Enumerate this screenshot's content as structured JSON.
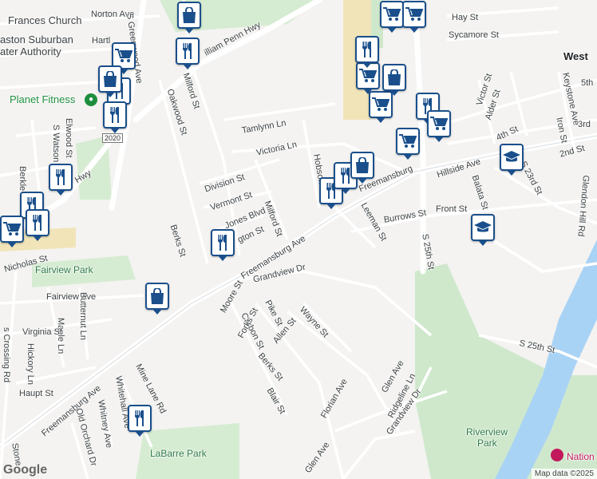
{
  "map": {
    "attribution": "Map data ©2025",
    "logo": "Google",
    "route_badge": "2020",
    "colors": {
      "background": "#f4f3f1",
      "park": "#c8e6c9",
      "water": "#a9d3f5",
      "road": "#ffffff",
      "highlight": "#f1e4b8",
      "marker_border": "#1a4f8b"
    }
  },
  "places": {
    "church": "Frances Church",
    "authority_1": "aston Suburban",
    "authority_2": "ater Authority",
    "gym": "Planet Fitness",
    "fairview_park": "Fairview Park",
    "labarre_park": "LaBarre Park",
    "riverview_1": "Riverview",
    "riverview_2": "Park",
    "west": "West",
    "national": "Nation"
  },
  "streets": {
    "norton": "Norton Ave",
    "hartl": "Hartl",
    "greenwood": "S Greenwood Ave",
    "penn_hwy": "illiam Penn Hwy",
    "milford_top": "Milford St",
    "oakwood": "Oakwood St",
    "tamlynn": "Tamlynn Ln",
    "victoria": "Victoria Ln",
    "division": "Division St",
    "vermont": "Vermont St",
    "jones": "Jones Blvd",
    "milford_mid": "Milford St",
    "hobson": "Hobson",
    "freemansburg_top": "Freemansburg",
    "leeman": "Leeman St",
    "burrows": "Burrows St",
    "front": "Front St",
    "s25": "S 25th St",
    "berks": "Berks St",
    "lexington": "gton St",
    "freemansburg_mid": "Freemansburg Ave",
    "grandview": "Grandview Dr",
    "moore": "Moore St",
    "carbon": "Carbon St",
    "pike": "Pike St",
    "wayne": "Wayne St",
    "forks": "Forks St",
    "allen": "Allen St",
    "berks2": "Berks St",
    "blair": "Blair St",
    "florian": "Florian Ave",
    "glen_ave_top": "Glen Ave",
    "ridgeline": "Ridgeline Ln",
    "grandview2": "Grandview Dr",
    "glen_ave_bot": "Glen Ave",
    "s25th_st": "S 25th St",
    "hay": "Hay St",
    "sycamore": "Sycamore St",
    "victor": "Victor St",
    "alder": "Alder St",
    "4th": "4th St",
    "3rd": "3rd",
    "2nd": "2nd St",
    "5th": "5th",
    "keystone": "Keystone Ave",
    "iron": "Iron St",
    "s23": "S 23rd St",
    "balata": "Balata St",
    "hillside": "Hillside Ave",
    "glendon": "Glendon Hill Rd",
    "elwood": "Elwood St",
    "watson": "S Watson St",
    "berkley": "Berkle",
    "nicholas": "Nicholas St",
    "fairview_ave": "Fairview Ave",
    "butternut": "Butternut Ln",
    "maple": "Maple Ln",
    "virginia": "Virginia St",
    "hickory": "Hickory Ln",
    "haupt": "Haupt St",
    "crossing": "s Crossing Rd",
    "freemansburg_bot": "Freemansburg Ave",
    "mine_lane": "Mine Lane Rd",
    "whitehall": "Whitehall Ave",
    "whitney": "Whitney Ave",
    "old_orchard": "Old Orchard Dr",
    "stone": "Stone",
    "hwy": "Hwy"
  },
  "markers": [
    {
      "kind": "shopping-bag-icon"
    },
    {
      "kind": "restaurant-icon"
    },
    {
      "kind": "grocery-cart-icon"
    },
    {
      "kind": "restaurant-icon"
    },
    {
      "kind": "restaurant-icon"
    },
    {
      "kind": "shopping-bag-icon"
    },
    {
      "kind": "restaurant-icon"
    },
    {
      "kind": "restaurant-icon"
    },
    {
      "kind": "grocery-cart-icon"
    },
    {
      "kind": "restaurant-icon"
    },
    {
      "kind": "shopping-bag-icon"
    },
    {
      "kind": "restaurant-icon"
    },
    {
      "kind": "restaurant-icon"
    },
    {
      "kind": "restaurant-icon"
    },
    {
      "kind": "shopping-bag-icon"
    },
    {
      "kind": "grocery-cart-icon"
    },
    {
      "kind": "grocery-cart-icon"
    },
    {
      "kind": "restaurant-icon"
    },
    {
      "kind": "grocery-cart-icon"
    },
    {
      "kind": "shopping-bag-icon"
    },
    {
      "kind": "grocery-cart-icon"
    },
    {
      "kind": "restaurant-icon"
    },
    {
      "kind": "grocery-cart-icon"
    },
    {
      "kind": "grocery-cart-icon"
    },
    {
      "kind": "school-icon"
    },
    {
      "kind": "school-icon"
    }
  ]
}
